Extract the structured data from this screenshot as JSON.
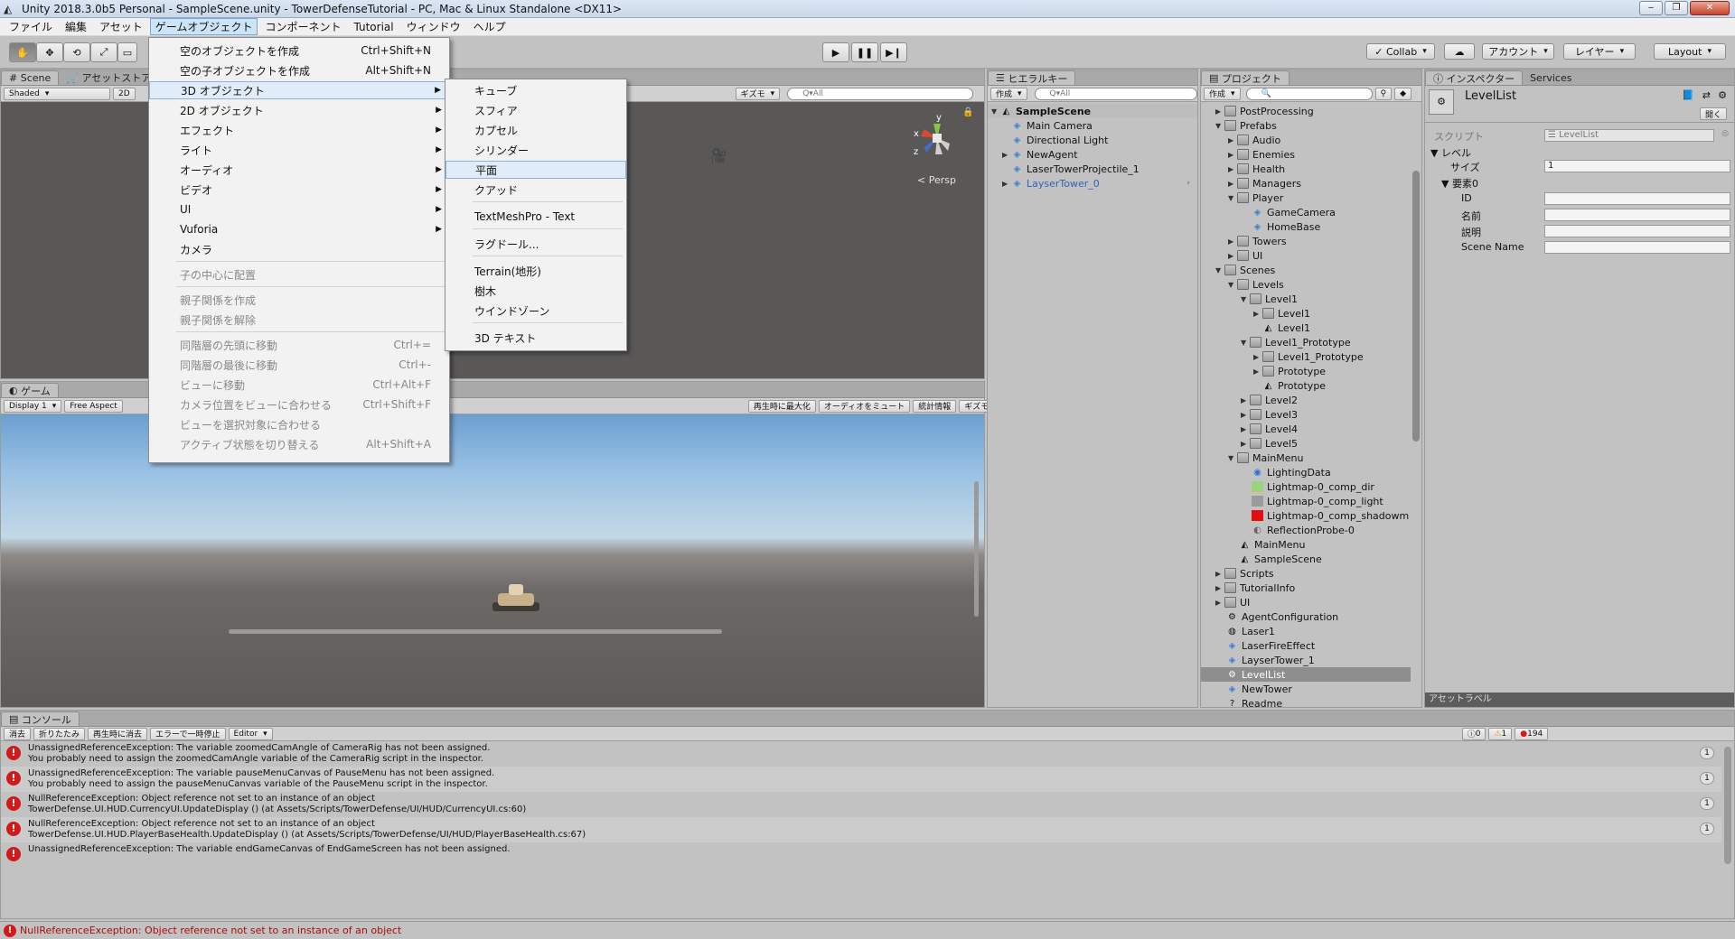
{
  "window": {
    "title": "Unity 2018.3.0b5 Personal - SampleScene.unity - TowerDefenseTutorial - PC, Mac & Linux Standalone <DX11>"
  },
  "menubar": [
    "ファイル",
    "編集",
    "アセット",
    "ゲームオブジェクト",
    "コンポーネント",
    "Tutorial",
    "ウィンドウ",
    "ヘルプ"
  ],
  "toolbar": {
    "collab": "Collab",
    "account": "アカウント",
    "layers": "レイヤー",
    "layout": "Layout"
  },
  "scene": {
    "tabs": [
      "Scene",
      "アセットストア"
    ],
    "shading": "Shaded",
    "mode2d": "2D",
    "gizmos": "ギズモ",
    "search": "Q▾All",
    "persp": "< Persp",
    "axis_x": "x",
    "axis_y": "y",
    "axis_z": "z"
  },
  "game": {
    "tab": "ゲーム",
    "display": "Display 1",
    "aspect": "Free Aspect",
    "maximize": "再生時に最大化",
    "mute": "オーディオをミュート",
    "stats": "統計情報",
    "gizmos": "ギズモ"
  },
  "hierarchy": {
    "tab": "ヒエラルキー",
    "create": "作成",
    "search": "Q▾All",
    "scene": "SampleScene",
    "items": [
      "Main Camera",
      "Directional Light",
      "NewAgent",
      "LaserTowerProjectile_1",
      "LayserTower_0"
    ]
  },
  "project": {
    "tab": "プロジェクト",
    "create": "作成",
    "items": [
      "PostProcessing",
      "Prefabs",
      "Audio",
      "Enemies",
      "Health",
      "Managers",
      "Player",
      "GameCamera",
      "HomeBase",
      "Towers",
      "UI",
      "Scenes",
      "Levels",
      "Level1",
      "Level1",
      "Level1",
      "Level1_Prototype",
      "Level1_Prototype",
      "Prototype",
      "Prototype",
      "Level2",
      "Level3",
      "Level4",
      "Level5",
      "MainMenu",
      "LightingData",
      "Lightmap-0_comp_dir",
      "Lightmap-0_comp_light",
      "Lightmap-0_comp_shadowm",
      "ReflectionProbe-0",
      "MainMenu",
      "SampleScene",
      "Scripts",
      "TutorialInfo",
      "UI",
      "AgentConfiguration",
      "Laser1",
      "LaserFireEffect",
      "LayserTower_1",
      "LevelList",
      "NewTower",
      "Readme"
    ]
  },
  "inspector": {
    "tabs": [
      "インスペクター",
      "Services"
    ],
    "object": "LevelList",
    "open": "開く",
    "script_label": "スクリプト",
    "script_value": "LevelList",
    "level": "レベル",
    "size_label": "サイズ",
    "size_value": "1",
    "element": "要素0",
    "fields": [
      "ID",
      "名前",
      "説明",
      "Scene Name"
    ],
    "asset_label": "アセットラベル"
  },
  "console": {
    "tab": "コンソール",
    "buttons": [
      "消去",
      "折りたたみ",
      "再生時に消去",
      "エラーで一時停止",
      "Editor"
    ],
    "counts": {
      "info": "0",
      "warn": "1",
      "error": "194"
    },
    "entries": [
      {
        "l1": "UnassignedReferenceException: The variable zoomedCamAngle of CameraRig has not been assigned.",
        "l2": "You probably need to assign the zoomedCamAngle variable of the CameraRig script in the inspector.",
        "count": "1"
      },
      {
        "l1": "UnassignedReferenceException: The variable pauseMenuCanvas of PauseMenu has not been assigned.",
        "l2": "You probably need to assign the pauseMenuCanvas variable of the PauseMenu script in the inspector.",
        "count": "1"
      },
      {
        "l1": "NullReferenceException: Object reference not set to an instance of an object",
        "l2": "TowerDefense.UI.HUD.CurrencyUI.UpdateDisplay () (at Assets/Scripts/TowerDefense/UI/HUD/CurrencyUI.cs:60)",
        "count": "1"
      },
      {
        "l1": "NullReferenceException: Object reference not set to an instance of an object",
        "l2": "TowerDefense.UI.HUD.PlayerBaseHealth.UpdateDisplay () (at Assets/Scripts/TowerDefense/UI/HUD/PlayerBaseHealth.cs:67)",
        "count": "1"
      },
      {
        "l1": "UnassignedReferenceException: The variable endGameCanvas of EndGameScreen has not been assigned.",
        "l2": "",
        "count": ""
      }
    ],
    "status": "NullReferenceException: Object reference not set to an instance of an object"
  },
  "gameobject_menu": [
    {
      "label": "空のオブジェクトを作成",
      "shortcut": "Ctrl+Shift+N"
    },
    {
      "label": "空の子オブジェクトを作成",
      "shortcut": "Alt+Shift+N"
    },
    {
      "label": "3D オブジェクト",
      "shortcut": ""
    },
    {
      "label": "2D オブジェクト",
      "shortcut": ""
    },
    {
      "label": "エフェクト",
      "shortcut": ""
    },
    {
      "label": "ライト",
      "shortcut": ""
    },
    {
      "label": "オーディオ",
      "shortcut": ""
    },
    {
      "label": "ビデオ",
      "shortcut": ""
    },
    {
      "label": "UI",
      "shortcut": ""
    },
    {
      "label": "Vuforia",
      "shortcut": ""
    },
    {
      "label": "カメラ",
      "shortcut": ""
    },
    {
      "label": "子の中心に配置",
      "shortcut": ""
    },
    {
      "label": "親子関係を作成",
      "shortcut": ""
    },
    {
      "label": "親子関係を解除",
      "shortcut": ""
    },
    {
      "label": "同階層の先頭に移動",
      "shortcut": "Ctrl+="
    },
    {
      "label": "同階層の最後に移動",
      "shortcut": "Ctrl+-"
    },
    {
      "label": "ビューに移動",
      "shortcut": "Ctrl+Alt+F"
    },
    {
      "label": "カメラ位置をビューに合わせる",
      "shortcut": "Ctrl+Shift+F"
    },
    {
      "label": "ビューを選択対象に合わせる",
      "shortcut": ""
    },
    {
      "label": "アクティブ状態を切り替える",
      "shortcut": "Alt+Shift+A"
    }
  ],
  "object3d_menu": [
    "キューブ",
    "スフィア",
    "カプセル",
    "シリンダー",
    "平面",
    "クアッド",
    "TextMeshPro - Text",
    "ラグドール...",
    "Terrain(地形)",
    "樹木",
    "ウインドゾーン",
    "3D テキスト"
  ]
}
